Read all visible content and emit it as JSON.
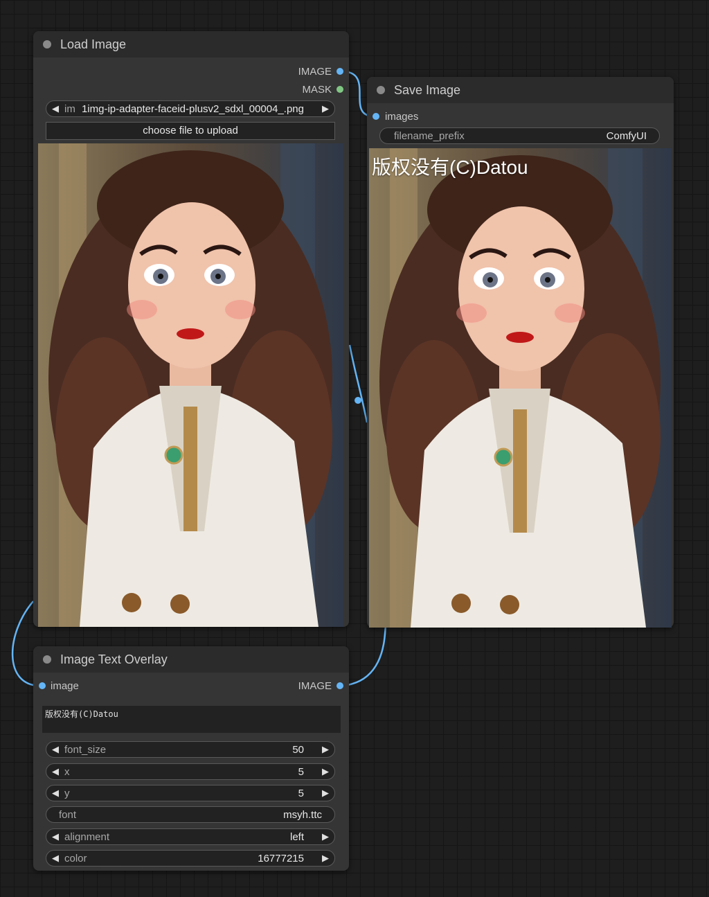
{
  "colors": {
    "image_port": "#64b5f6",
    "mask_port": "#81c784",
    "wire": "#64b5f6"
  },
  "load_image": {
    "title": "Load Image",
    "outputs": [
      "IMAGE",
      "MASK"
    ],
    "image_widget": {
      "prefix_fragment": "im",
      "value": "1img-ip-adapter-faceid-plusv2_sdxl_00004_.png"
    },
    "upload_label": "choose file to upload"
  },
  "save_image": {
    "title": "Save Image",
    "input": "images",
    "filename_prefix": {
      "label": "filename_prefix",
      "value": "ComfyUI"
    },
    "overlay_text": "版权没有(C)Datou"
  },
  "text_overlay": {
    "title": "Image Text Overlay",
    "input": "image",
    "output": "IMAGE",
    "text": "版权没有(C)Datou",
    "widgets": [
      {
        "label": "font_size",
        "value": "50",
        "arrows": true
      },
      {
        "label": "x",
        "value": "5",
        "arrows": true
      },
      {
        "label": "y",
        "value": "5",
        "arrows": true
      },
      {
        "label": "font",
        "value": "msyh.ttc",
        "arrows": false
      },
      {
        "label": "alignment",
        "value": "left",
        "arrows": true
      },
      {
        "label": "color",
        "value": "16777215",
        "arrows": true
      }
    ]
  }
}
